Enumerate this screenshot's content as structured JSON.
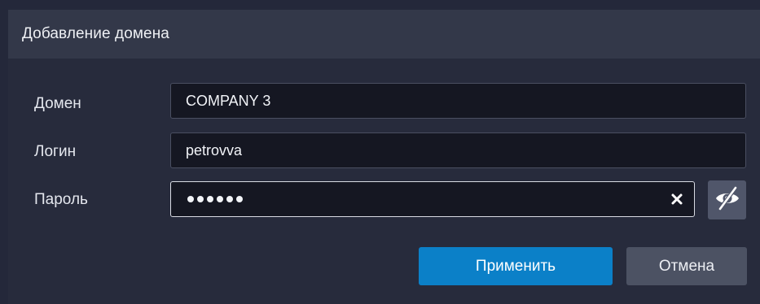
{
  "dialog": {
    "title": "Добавление домена"
  },
  "fields": {
    "domain": {
      "label": "Домен",
      "value": "COMPANY 3"
    },
    "login": {
      "label": "Логин",
      "value": "petrovva"
    },
    "password": {
      "label": "Пароль",
      "masked_length": 6
    }
  },
  "icons": {
    "clear": "close-icon",
    "toggle_visibility": "eye-slash-icon"
  },
  "buttons": {
    "apply_label": "Применить",
    "cancel_label": "Отмена"
  },
  "colors": {
    "accent": "#0b80c8",
    "background": "#272b3c",
    "titlebar": "#333849"
  }
}
